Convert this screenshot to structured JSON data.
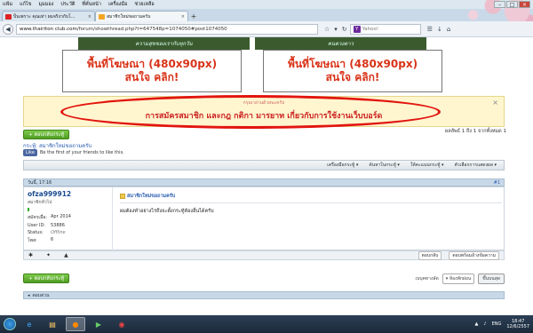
{
  "menu": [
    "แฟ้ม",
    "แก้ไข",
    "มุมมอง",
    "ประวัติ",
    "ที่คั่นหน้า",
    "เครื่องมือ",
    "ช่วยเหลือ"
  ],
  "tabs": [
    {
      "label": "ป็นเพราะ คุณเท่า ผมจริงวกับโ...",
      "active": false
    },
    {
      "label": "สมาชิกใหม่ขอถามครับ",
      "active": true
    }
  ],
  "new_tab": "+",
  "address": {
    "host": "www.thairiton club.com",
    "path": "/forum/showthread.php?t=647548p=1074050#post1074050"
  },
  "search": {
    "placeholder": "Yahoo!"
  },
  "banner_top": [
    "ความสุขของเรากับทุกวัน",
    "คนดวงดาว"
  ],
  "ads": [
    {
      "line1": "พื้นที่โฆษณา (480x90px)",
      "line2": "สนใจ คลิก!"
    },
    {
      "line1": "พื้นที่โฆษณา (480x90px)",
      "line2": "สนใจ คลิก!"
    }
  ],
  "notice": {
    "small": "กรุณาอ่านด้วยนะครับ",
    "big": "การสมัครสมาชิก และกฎ กติกา มารยาท เกี่ยวกับการใช้งานเว็บบอร์ด",
    "close": "×"
  },
  "reply_button": "ตอบกลับกระทู้",
  "pager_info": "ผลลัพธ์ 1 ถึง 1 จากทั้งหมด 1",
  "thread": {
    "label": "กระทู้:",
    "title": "สมาชิกใหม่ขอถามครับ"
  },
  "fb": {
    "like": "Like",
    "text": "Be the first of your friends to like this."
  },
  "toolbar": [
    "เครื่องมือกระทู้ ▾",
    "ค้นหาในกระทู้ ▾",
    "ให้คะแนนกระทู้ ▾",
    "ตัวเลือกการแสดงผล ▾"
  ],
  "post": {
    "date": "วันนี้, 17:16",
    "number": "#1",
    "username": "ofza999912",
    "rank": "สมาชิกทั่วไป",
    "info": [
      {
        "k": "สมัครเมื่อ:",
        "v": "Apr 2014"
      },
      {
        "k": "User ID:",
        "v": "53886"
      },
      {
        "k": "Status:",
        "v": "Offline"
      },
      {
        "k": "โพส:",
        "v": "6"
      }
    ],
    "title": "สมาชิกใหม่ขอถามครับ",
    "body": "ผมต้องทำอย่างไรถึงจะตั้งกระทู้ห้องอื่นได้ครับ"
  },
  "post_actions": {
    "reply": "ตอบกลับ",
    "quote": "ตอบพร้อมอ้างข้อความ"
  },
  "bottom": {
    "label": "เบบุคทางลัด",
    "select": "▾ ห้องพักผ่อน",
    "go": "ขึ้นบนสุด"
  },
  "quick_reply": "ตอบด่วน",
  "tray": {
    "lang": "ENG",
    "time": "18:47",
    "date": "12/6/2557"
  }
}
